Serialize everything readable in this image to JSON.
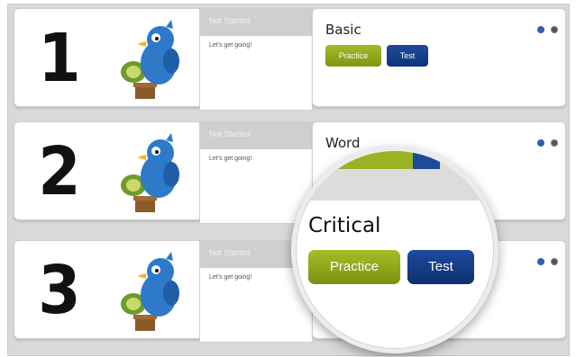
{
  "rows": [
    {
      "number": "1",
      "status": "Not Started",
      "message": "Let's get going!",
      "level": "Basic",
      "practice_label": "Practice",
      "test_label": "Test"
    },
    {
      "number": "2",
      "status": "Not Started",
      "message": "Let's get going!",
      "level": "Word",
      "practice_label": "",
      "test_label": ""
    },
    {
      "number": "3",
      "status": "Not Started",
      "message": "Let's get going!",
      "level": "",
      "practice_label": "",
      "test_label": ""
    }
  ],
  "magnifier": {
    "level": "Critical",
    "practice_label": "Practice",
    "test_label": "Test"
  },
  "icons": {
    "help": "help-icon",
    "settings": "gear-icon",
    "mascot": "bird-mascot-icon"
  },
  "colors": {
    "practice": "#8ea51c",
    "test": "#163f8a",
    "status_header": "#cfcfcf",
    "mascot_blue": "#2f79c9"
  }
}
